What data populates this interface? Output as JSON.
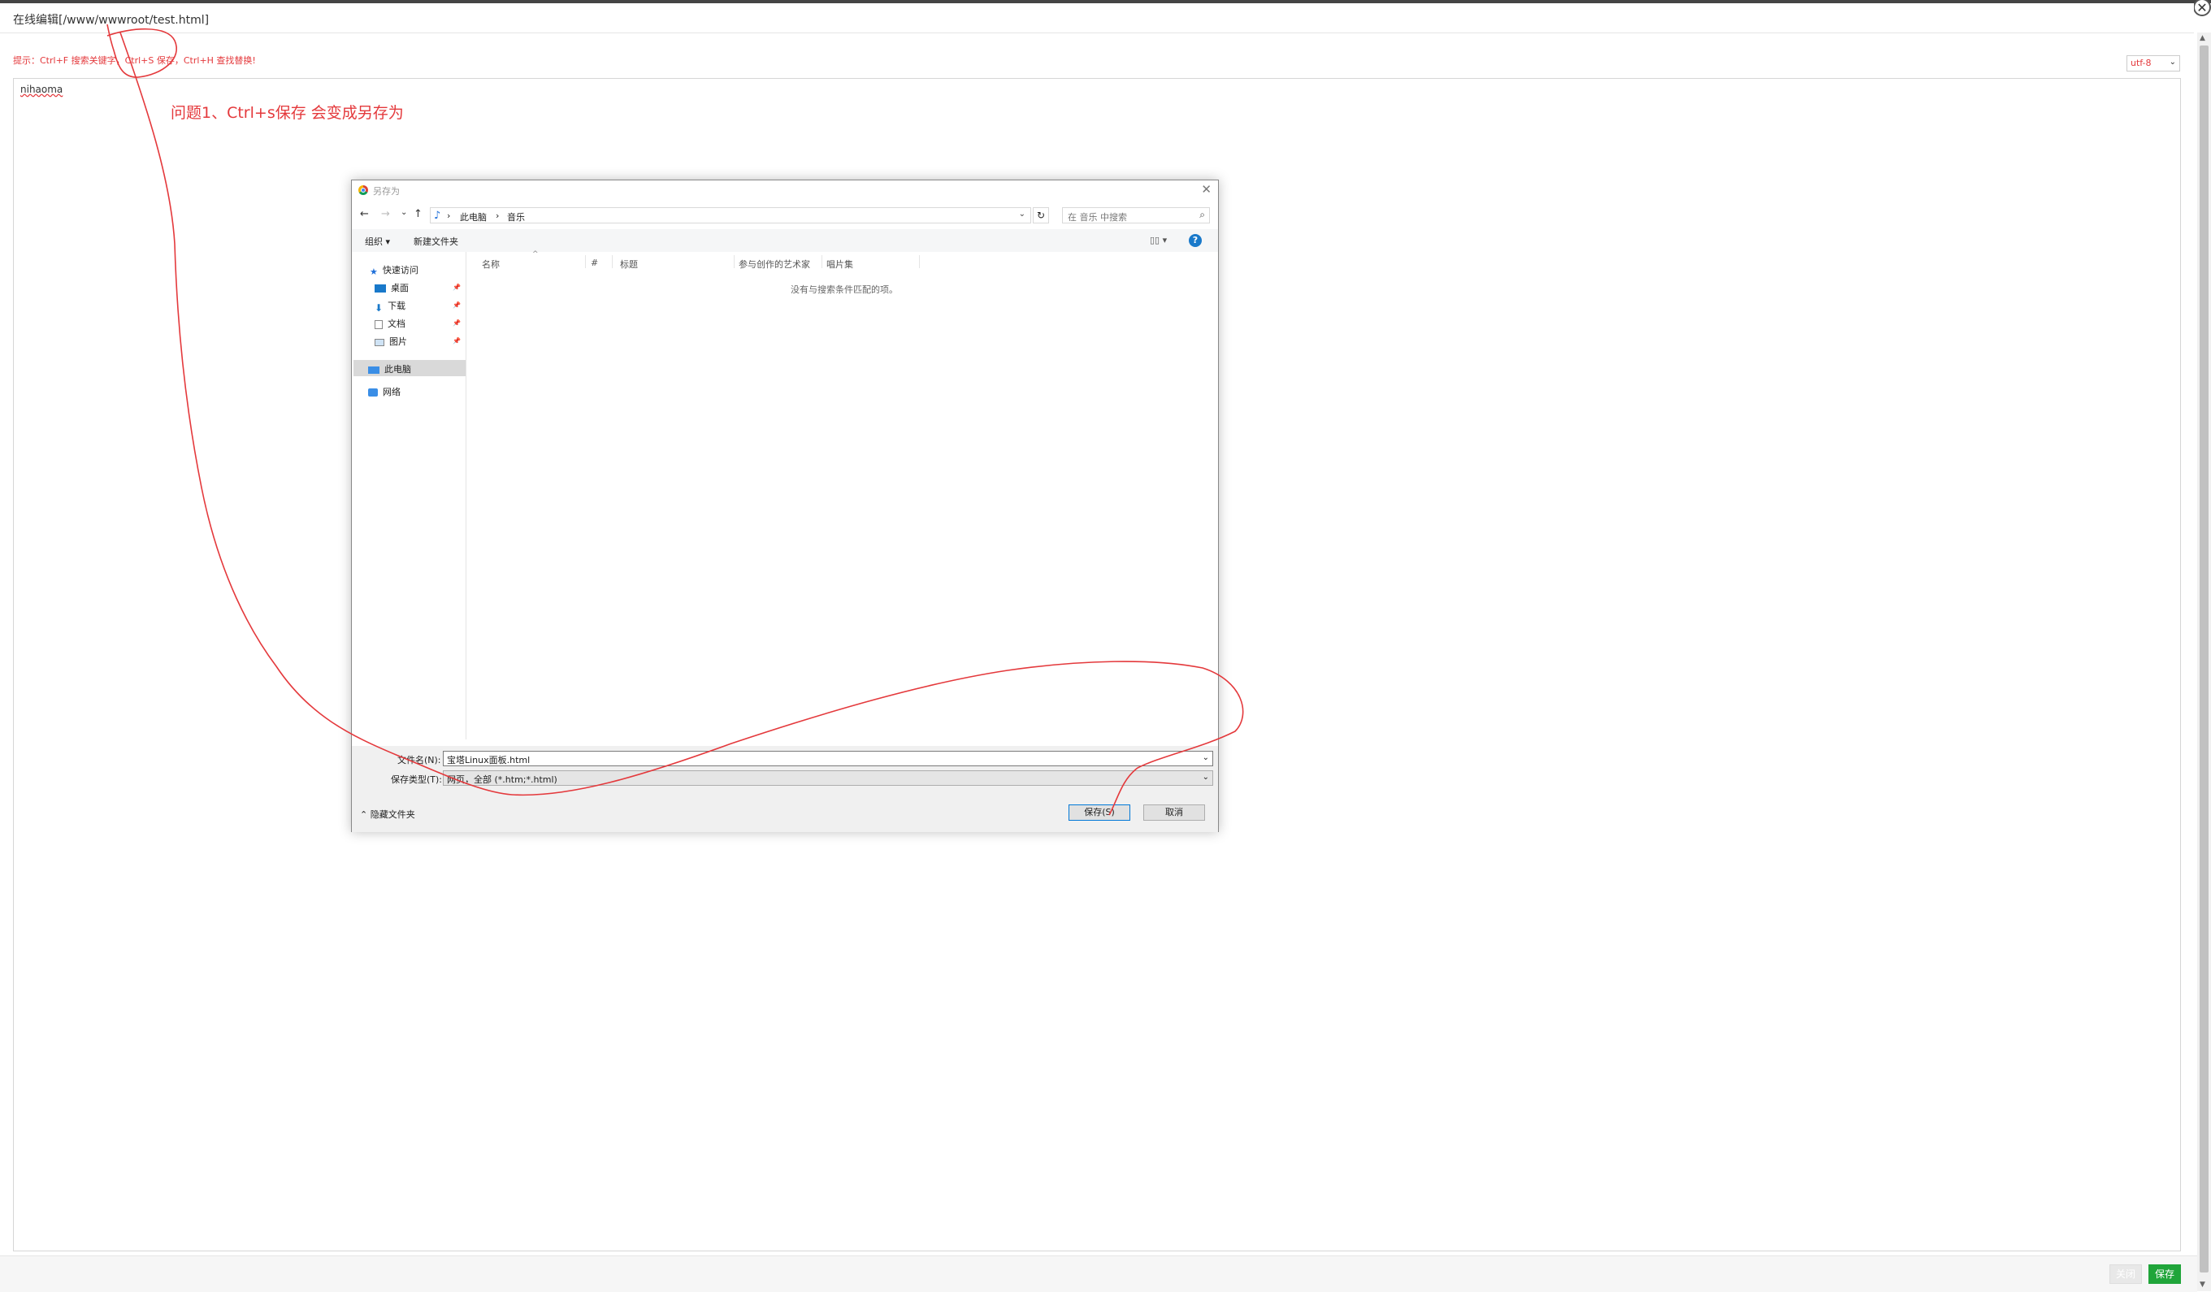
{
  "page": {
    "title": "在线编辑[/www/wwwroot/test.html]",
    "tip": "提示：Ctrl+F 搜索关键字，Ctrl+S 保存，Ctrl+H 查找替换!",
    "encoding": "utf-8",
    "editor_content": "nihaoma",
    "annotation": "问题1、Ctrl+s保存 会变成另存为",
    "close_label": "关闭",
    "save_label": "保存",
    "close_x": "✕"
  },
  "dialog": {
    "title": "另存为",
    "close_x": "✕",
    "nav": {
      "back": "←",
      "forward": "→",
      "recent": "⌄",
      "up": "↑"
    },
    "breadcrumb": [
      "此电脑",
      "音乐"
    ],
    "breadcrumb_sep": "›",
    "refresh": "↻",
    "search_placeholder": "在 音乐 中搜索",
    "toolbar": {
      "organize": "组织 ▾",
      "new_folder": "新建文件夹",
      "view": "▯▯ ▾",
      "help": "?"
    },
    "nav_pane": {
      "quick_access": "快速访问",
      "items": [
        "桌面",
        "下载",
        "文档",
        "图片"
      ],
      "this_pc": "此电脑",
      "network": "网络"
    },
    "columns": [
      "名称",
      "#",
      "标题",
      "参与创作的艺术家",
      "唱片集"
    ],
    "sort_caret": "^",
    "empty_message": "没有与搜索条件匹配的项。",
    "filename_label": "文件名(N):",
    "filename_value": "宝塔Linux面板.html",
    "filetype_label": "保存类型(T):",
    "filetype_value": "网页，全部 (*.htm;*.html)",
    "hide_folders": "隐藏文件夹",
    "save_button": "保存(S)",
    "cancel_button": "取消"
  },
  "colors": {
    "annotation_red": "#e4393c",
    "save_green": "#20a53a",
    "help_blue": "#1979ca"
  }
}
